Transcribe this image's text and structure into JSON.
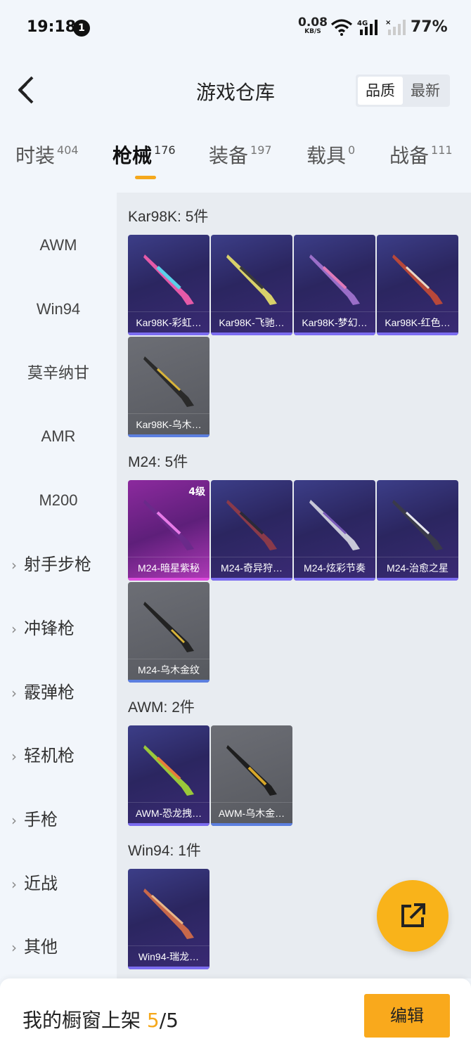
{
  "status_bar": {
    "time": "19:18",
    "notification_count": "1",
    "net_speed": "0.08",
    "net_unit": "KB/S",
    "battery": "77%"
  },
  "header": {
    "title": "游戏仓库",
    "sort_options": [
      "品质",
      "最新"
    ],
    "active_sort": "品质"
  },
  "tabs": [
    {
      "label": "时装",
      "count": "404"
    },
    {
      "label": "枪械",
      "count": "176"
    },
    {
      "label": "装备",
      "count": "197"
    },
    {
      "label": "载具",
      "count": "0"
    },
    {
      "label": "战备",
      "count": "111"
    }
  ],
  "active_tab": "枪械",
  "sidebar": {
    "items": [
      "AWM",
      "Win94",
      "莫辛纳甘",
      "AMR",
      "M200"
    ],
    "groups": [
      "射手步枪",
      "冲锋枪",
      "霰弹枪",
      "轻机枪",
      "手枪",
      "近战",
      "其他"
    ]
  },
  "sections": [
    {
      "title": "Kar98K: 5件",
      "items": [
        {
          "name": "Kar98K-彩虹…",
          "rarity": "purple"
        },
        {
          "name": "Kar98K-飞驰…",
          "rarity": "purple"
        },
        {
          "name": "Kar98K-梦幻…",
          "rarity": "purple"
        },
        {
          "name": "Kar98K-红色…",
          "rarity": "purple"
        },
        {
          "name": "Kar98K-乌木…",
          "rarity": "gray"
        }
      ]
    },
    {
      "title": "M24: 5件",
      "items": [
        {
          "name": "M24-暗星紫秘",
          "rarity": "pink",
          "level": "4级"
        },
        {
          "name": "M24-奇异狩…",
          "rarity": "purple"
        },
        {
          "name": "M24-炫彩节奏",
          "rarity": "purple"
        },
        {
          "name": "M24-治愈之星",
          "rarity": "purple"
        },
        {
          "name": "M24-乌木金纹",
          "rarity": "gray"
        }
      ]
    },
    {
      "title": "AWM: 2件",
      "items": [
        {
          "name": "AWM-恐龙拽…",
          "rarity": "purple"
        },
        {
          "name": "AWM-乌木金…",
          "rarity": "gray"
        }
      ]
    },
    {
      "title": "Win94: 1件",
      "items": [
        {
          "name": "Win94-瑞龙…",
          "rarity": "purple"
        }
      ]
    }
  ],
  "bottom_bar": {
    "showcase_label": "我的橱窗上架",
    "showcase_count": "5",
    "showcase_total": "/5",
    "edit_button": "编辑"
  },
  "colors": {
    "accent": "#f9a91c",
    "rarity_purple": "#7b6cf0",
    "rarity_pink": "#e04ee0",
    "rarity_gray": "#5c7fe0"
  }
}
